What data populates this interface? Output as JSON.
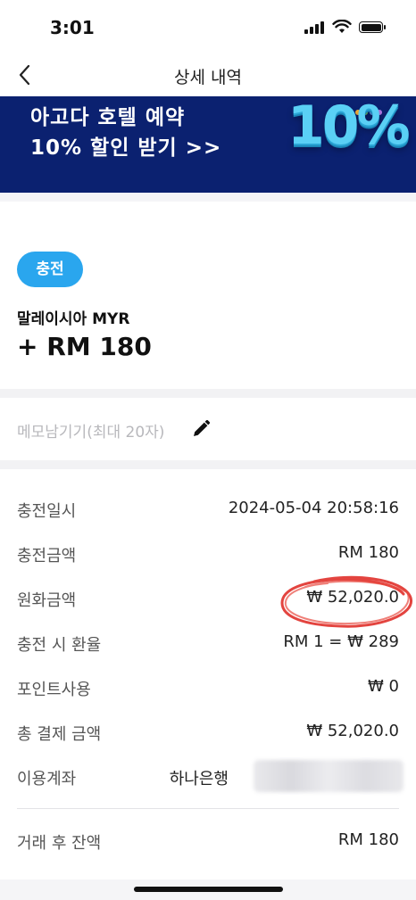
{
  "status_bar": {
    "time": "3:01"
  },
  "header": {
    "title": "상세 내역"
  },
  "banner": {
    "line1": "아고다 호텔 예약",
    "line2": "10% 할인 받기 >>",
    "promo": "10%"
  },
  "charge": {
    "badge": "충전",
    "currency": "말레이시아 MYR",
    "amount": "+ RM 180"
  },
  "memo": {
    "placeholder": "메모남기기(최대 20자)"
  },
  "details": [
    {
      "label": "충전일시",
      "value": "2024-05-04 20:58:16"
    },
    {
      "label": "충전금액",
      "value": "RM 180"
    },
    {
      "label": "원화금액",
      "value": "₩ 52,020.0"
    },
    {
      "label": "충전 시 환율",
      "value": "RM 1 = ₩ 289"
    },
    {
      "label": "포인트사용",
      "value": "₩ 0"
    },
    {
      "label": "총 결제 금액",
      "value": "₩ 52,020.0"
    },
    {
      "label": "이용계좌",
      "value": "하나은행"
    }
  ],
  "balance": {
    "label": "거래 후 잔액",
    "value": "RM 180"
  },
  "colors": {
    "banner_bg": "#0b2170",
    "badge_bg": "#2aa6ee",
    "promo": "#5ad0f5",
    "annotation": "#e0302a"
  },
  "icons": [
    "back-chevron-icon",
    "pencil-icon",
    "signal-icon",
    "wifi-icon",
    "battery-icon"
  ]
}
